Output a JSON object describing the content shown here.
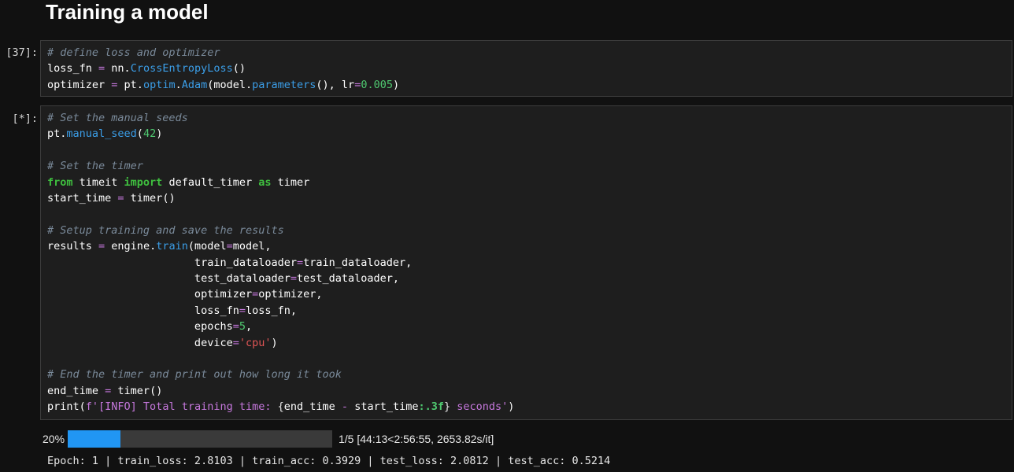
{
  "heading": "Training a model",
  "cells": [
    {
      "prompt": "[37]:",
      "lines": [
        [
          [
            "cm",
            "# define loss and optimizer"
          ]
        ],
        [
          [
            "",
            "loss_fn "
          ],
          [
            "op",
            "="
          ],
          [
            "",
            " nn."
          ],
          [
            "fn",
            "CrossEntropyLoss"
          ],
          [
            "",
            "()"
          ]
        ],
        [
          [
            "",
            "optimizer "
          ],
          [
            "op",
            "="
          ],
          [
            "",
            " pt."
          ],
          [
            "fn",
            "optim"
          ],
          [
            "",
            "."
          ],
          [
            "fn",
            "Adam"
          ],
          [
            "",
            "(model."
          ],
          [
            "fn",
            "parameters"
          ],
          [
            "",
            "(), lr"
          ],
          [
            "op",
            "="
          ],
          [
            "num",
            "0.005"
          ],
          [
            "",
            ")"
          ]
        ]
      ]
    },
    {
      "prompt": "[*]:",
      "lines": [
        [
          [
            "cm",
            "# Set the manual seeds"
          ]
        ],
        [
          [
            "",
            "pt."
          ],
          [
            "fn",
            "manual_seed"
          ],
          [
            "",
            "("
          ],
          [
            "num",
            "42"
          ],
          [
            "",
            ")"
          ]
        ],
        [],
        [
          [
            "cm",
            "# Set the timer"
          ]
        ],
        [
          [
            "kw",
            "from"
          ],
          [
            "",
            " timeit "
          ],
          [
            "kw",
            "import"
          ],
          [
            "",
            " default_timer "
          ],
          [
            "kw",
            "as"
          ],
          [
            "",
            " timer"
          ]
        ],
        [
          [
            "",
            "start_time "
          ],
          [
            "op",
            "="
          ],
          [
            "",
            " timer()"
          ]
        ],
        [],
        [
          [
            "cm",
            "# Setup training and save the results"
          ]
        ],
        [
          [
            "",
            "results "
          ],
          [
            "op",
            "="
          ],
          [
            "",
            " engine."
          ],
          [
            "fn",
            "train"
          ],
          [
            "",
            "(model"
          ],
          [
            "op",
            "="
          ],
          [
            "",
            "model,"
          ]
        ],
        [
          [
            "",
            "                       train_dataloader"
          ],
          [
            "op",
            "="
          ],
          [
            "",
            "train_dataloader,"
          ]
        ],
        [
          [
            "",
            "                       test_dataloader"
          ],
          [
            "op",
            "="
          ],
          [
            "",
            "test_dataloader,"
          ]
        ],
        [
          [
            "",
            "                       optimizer"
          ],
          [
            "op",
            "="
          ],
          [
            "",
            "optimizer,"
          ]
        ],
        [
          [
            "",
            "                       loss_fn"
          ],
          [
            "op",
            "="
          ],
          [
            "",
            "loss_fn,"
          ]
        ],
        [
          [
            "",
            "                       epochs"
          ],
          [
            "op",
            "="
          ],
          [
            "num",
            "5"
          ],
          [
            "",
            ","
          ]
        ],
        [
          [
            "",
            "                       device"
          ],
          [
            "op",
            "="
          ],
          [
            "str",
            "'cpu'"
          ],
          [
            "",
            ")"
          ]
        ],
        [],
        [
          [
            "cm",
            "# End the timer and print out how long it took"
          ]
        ],
        [
          [
            "",
            "end_time "
          ],
          [
            "op",
            "="
          ],
          [
            "",
            " timer()"
          ]
        ],
        [
          [
            "",
            "print("
          ],
          [
            "fstr",
            "f'[INFO] Total training time: "
          ],
          [
            "fbrace",
            "{"
          ],
          [
            "",
            "end_time "
          ],
          [
            "op",
            "-"
          ],
          [
            "",
            " start_time"
          ],
          [
            "fspec",
            ":.3f"
          ],
          [
            "fbrace",
            "}"
          ],
          [
            "fstr",
            " seconds'"
          ],
          [
            "",
            ")"
          ]
        ]
      ]
    }
  ],
  "progress": {
    "percent_label": "20%",
    "fraction": 0.2,
    "status_text": "1/5 [44:13<2:56:55, 2653.82s/it]"
  },
  "log_line": "Epoch: 1 | train_loss: 2.8103 | train_acc: 0.3929 | test_loss: 2.0812 | test_acc: 0.5214",
  "colors": {
    "background": "#111111",
    "cell_background": "#1e1e1e",
    "progress_fill": "#2196f3",
    "comment": "#7a8a9a",
    "keyword": "#3fbf3f",
    "function": "#3b9ee8",
    "number": "#4fc970",
    "operator": "#c678dd",
    "string": "#e05555"
  }
}
